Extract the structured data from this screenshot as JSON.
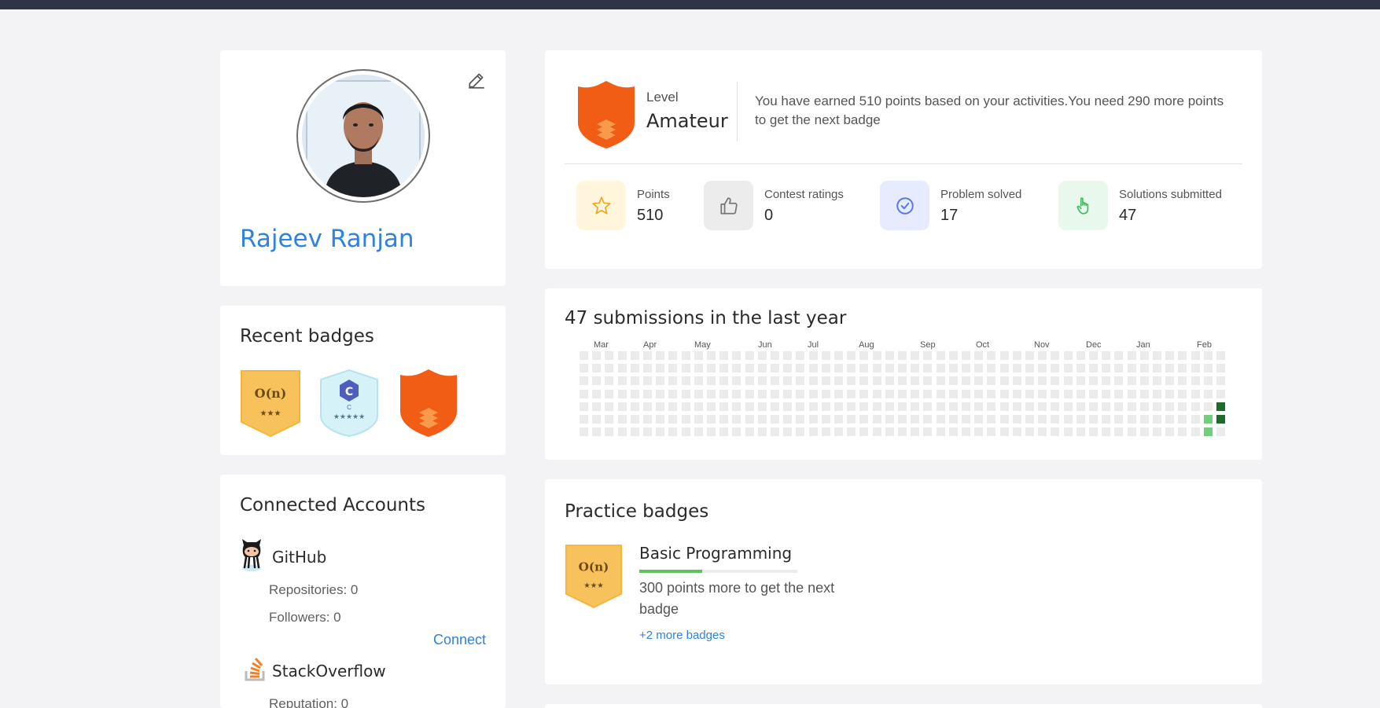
{
  "profile": {
    "name": "Rajeev Ranjan"
  },
  "recent_badges": {
    "title": "Recent badges",
    "items": [
      {
        "icon": "o-n-badge",
        "text": "O(n)",
        "stars": "★★★"
      },
      {
        "icon": "c-language-badge",
        "text": "C",
        "caption": "C",
        "stars": "★★★★★"
      },
      {
        "icon": "amateur-shield-badge"
      }
    ]
  },
  "connected_accounts": {
    "title": "Connected Accounts",
    "github": {
      "name": "GitHub",
      "repositories": "Repositories: 0",
      "followers": "Followers: 0",
      "connect": "Connect"
    },
    "stackoverflow": {
      "name": "StackOverflow",
      "reputation": "Reputation: 0"
    }
  },
  "level": {
    "label": "Level",
    "value": "Amateur",
    "message": "You have earned 510 points based on your activities.You need 290 more points to get the next badge"
  },
  "stats": [
    {
      "label": "Points",
      "value": "510",
      "icon": "star-icon",
      "color": "#fff6dd"
    },
    {
      "label": "Contest ratings",
      "value": "0",
      "icon": "thumbs-up-icon",
      "color": "#ececec"
    },
    {
      "label": "Problem solved",
      "value": "17",
      "icon": "check-circle-icon",
      "color": "#e6ecfd"
    },
    {
      "label": "Solutions submitted",
      "value": "47",
      "icon": "hand-pointer-icon",
      "color": "#e8f8ec"
    }
  ],
  "activity": {
    "title": "47 submissions in the last year",
    "months": [
      "Mar",
      "Apr",
      "May",
      "Jun",
      "Jul",
      "Aug",
      "Sep",
      "Oct",
      "Nov",
      "Dec",
      "Jan",
      "Feb"
    ],
    "weeks": 51,
    "active": [
      {
        "week": 50,
        "day": 4,
        "level": 2
      },
      {
        "week": 50,
        "day": 5,
        "level": 2
      },
      {
        "week": 49,
        "day": 5,
        "level": 1
      },
      {
        "week": 49,
        "day": 6,
        "level": 1
      }
    ],
    "colors": {
      "empty": "#ebebeb",
      "light": "#6fcf7a",
      "dark": "#1e6b2b"
    }
  },
  "practice": {
    "title": "Practice badges",
    "badge": {
      "icon": "o-n-badge",
      "text": "O(n)",
      "stars": "★★★"
    },
    "name": "Basic Programming",
    "progress": 0.4,
    "desc": "300 points more to get the next badge",
    "more": "+2 more badges"
  }
}
